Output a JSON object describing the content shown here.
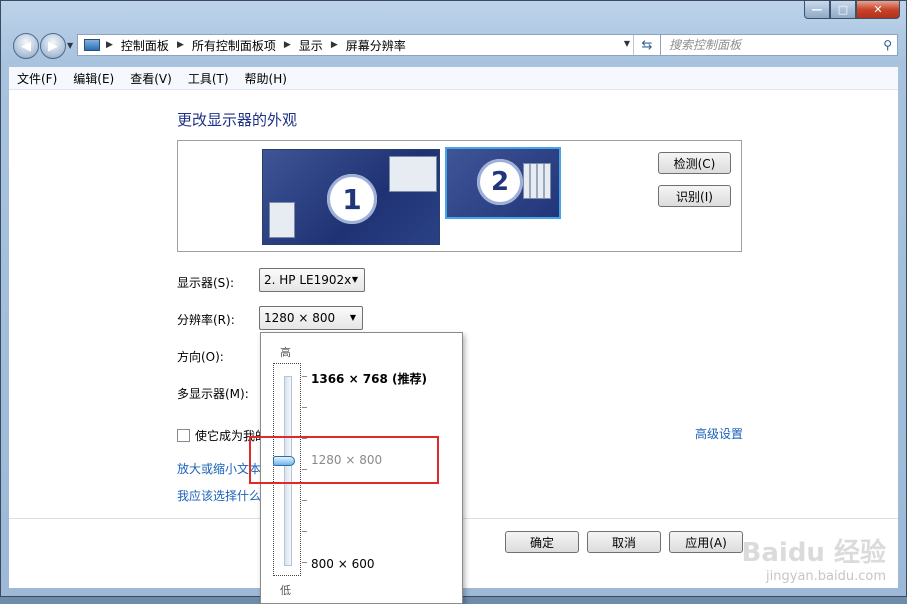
{
  "window": {
    "controls": {
      "minimize": "—",
      "maximize": "□",
      "close": "✕"
    }
  },
  "navigation": {
    "back_icon": "arrow-left-icon",
    "forward_icon": "arrow-right-icon",
    "breadcrumb": [
      "控制面板",
      "所有控制面板项",
      "显示",
      "屏幕分辨率"
    ],
    "search_placeholder": "搜索控制面板"
  },
  "menu": [
    "文件(F)",
    "编辑(E)",
    "查看(V)",
    "工具(T)",
    "帮助(H)"
  ],
  "page": {
    "title": "更改显示器的外观",
    "monitors": [
      {
        "number": "1"
      },
      {
        "number": "2"
      }
    ],
    "detect_button": "检测(C)",
    "identify_button": "识别(I)",
    "display_label": "显示器(S):",
    "display_value": "2. HP LE1902x",
    "resolution_label": "分辨率(R):",
    "resolution_value": "1280 × 800",
    "orientation_label": "方向(O):",
    "multi_display_label": "多显示器(M):",
    "primary_checkbox_label": "使它成为我的",
    "advanced_link": "高级设置",
    "link_text_size": "放大或缩小文本",
    "link_help": "我应该选择什么",
    "ok_button": "确定",
    "cancel_button": "取消",
    "apply_button": "应用(A)"
  },
  "resolution_popup": {
    "high_label": "高",
    "low_label": "低",
    "options": [
      "1366 × 768 (推荐)",
      "1280 × 800",
      "800 × 600"
    ],
    "selected": "1280 × 800"
  },
  "watermark": {
    "logo": "Baidu 经验",
    "url": "jingyan.baidu.com"
  }
}
